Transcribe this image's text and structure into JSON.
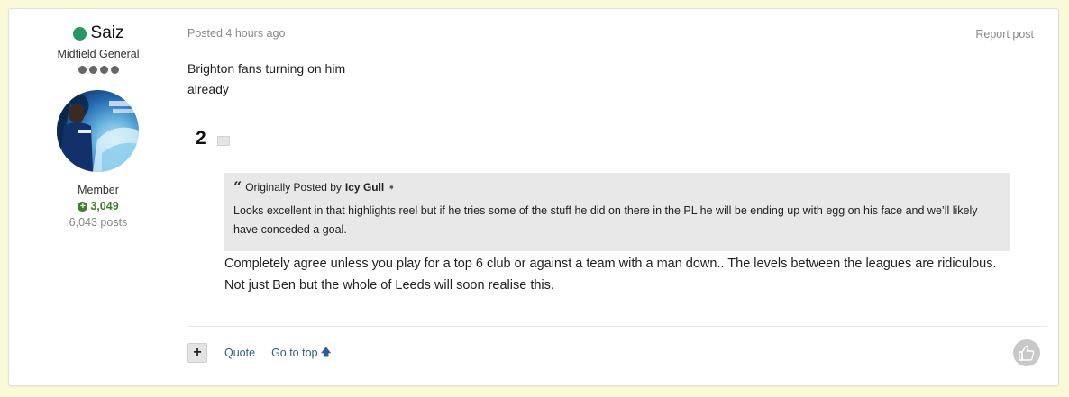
{
  "author": {
    "name": "Saiz",
    "rank": "Midfield General",
    "pips": 4,
    "group": "Member",
    "reputation": "3,049",
    "posts": "6,043 posts",
    "online_color": "#2a9465"
  },
  "post": {
    "meta": "Posted 4 hours ago",
    "report_label": "Report post",
    "body_lines": [
      "Brighton fans turning on him",
      "already"
    ],
    "number": "2",
    "quote": {
      "prefix": "Originally Posted by",
      "author": "Icy Gull",
      "text": "Looks excellent in that highlights reel but if he tries some of the stuff he did on there in the PL he will be ending up with egg on his face and we’ll likely have conceded a goal."
    },
    "reply": "Completely agree unless you play for a top 6 club or against a team with a man down.. The levels between the leagues are ridiculous. Not just Ben but the whole of Leeds will soon realise this."
  },
  "footer": {
    "plus_label": "+",
    "quote_label": "Quote",
    "top_label": "Go to top",
    "link_color": "#2e5f8e"
  },
  "icons": {
    "quote": "quote-icon",
    "like": "thumbs-up-icon",
    "up": "arrow-up-icon"
  }
}
